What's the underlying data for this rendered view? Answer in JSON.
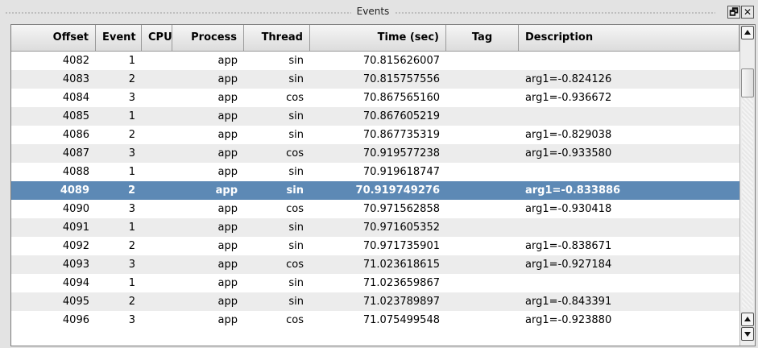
{
  "window": {
    "title": "Events",
    "float_button_glyph": "🗗",
    "close_button_glyph": "✕"
  },
  "table": {
    "columns": [
      {
        "key": "offset",
        "label": "Offset",
        "align": "right"
      },
      {
        "key": "event",
        "label": "Event",
        "align": "right"
      },
      {
        "key": "cpu",
        "label": "CPU",
        "align": "center"
      },
      {
        "key": "process",
        "label": "Process",
        "align": "right"
      },
      {
        "key": "thread",
        "label": "Thread",
        "align": "right"
      },
      {
        "key": "time",
        "label": "Time (sec)",
        "align": "right"
      },
      {
        "key": "tag",
        "label": "Tag",
        "align": "center"
      },
      {
        "key": "description",
        "label": "Description",
        "align": "left"
      }
    ],
    "selected_offset": "4089",
    "rows": [
      {
        "offset": "4082",
        "event": "1",
        "cpu": "",
        "process": "app",
        "thread": "sin",
        "time": "70.815626007",
        "tag": "",
        "description": ""
      },
      {
        "offset": "4083",
        "event": "2",
        "cpu": "",
        "process": "app",
        "thread": "sin",
        "time": "70.815757556",
        "tag": "",
        "description": "arg1=-0.824126"
      },
      {
        "offset": "4084",
        "event": "3",
        "cpu": "",
        "process": "app",
        "thread": "cos",
        "time": "70.867565160",
        "tag": "",
        "description": "arg1=-0.936672"
      },
      {
        "offset": "4085",
        "event": "1",
        "cpu": "",
        "process": "app",
        "thread": "sin",
        "time": "70.867605219",
        "tag": "",
        "description": ""
      },
      {
        "offset": "4086",
        "event": "2",
        "cpu": "",
        "process": "app",
        "thread": "sin",
        "time": "70.867735319",
        "tag": "",
        "description": "arg1=-0.829038"
      },
      {
        "offset": "4087",
        "event": "3",
        "cpu": "",
        "process": "app",
        "thread": "cos",
        "time": "70.919577238",
        "tag": "",
        "description": "arg1=-0.933580"
      },
      {
        "offset": "4088",
        "event": "1",
        "cpu": "",
        "process": "app",
        "thread": "sin",
        "time": "70.919618747",
        "tag": "",
        "description": ""
      },
      {
        "offset": "4089",
        "event": "2",
        "cpu": "",
        "process": "app",
        "thread": "sin",
        "time": "70.919749276",
        "tag": "",
        "description": "arg1=-0.833886"
      },
      {
        "offset": "4090",
        "event": "3",
        "cpu": "",
        "process": "app",
        "thread": "cos",
        "time": "70.971562858",
        "tag": "",
        "description": "arg1=-0.930418"
      },
      {
        "offset": "4091",
        "event": "1",
        "cpu": "",
        "process": "app",
        "thread": "sin",
        "time": "70.971605352",
        "tag": "",
        "description": ""
      },
      {
        "offset": "4092",
        "event": "2",
        "cpu": "",
        "process": "app",
        "thread": "sin",
        "time": "70.971735901",
        "tag": "",
        "description": "arg1=-0.838671"
      },
      {
        "offset": "4093",
        "event": "3",
        "cpu": "",
        "process": "app",
        "thread": "cos",
        "time": "71.023618615",
        "tag": "",
        "description": "arg1=-0.927184"
      },
      {
        "offset": "4094",
        "event": "1",
        "cpu": "",
        "process": "app",
        "thread": "sin",
        "time": "71.023659867",
        "tag": "",
        "description": ""
      },
      {
        "offset": "4095",
        "event": "2",
        "cpu": "",
        "process": "app",
        "thread": "sin",
        "time": "71.023789897",
        "tag": "",
        "description": "arg1=-0.843391"
      },
      {
        "offset": "4096",
        "event": "3",
        "cpu": "",
        "process": "app",
        "thread": "cos",
        "time": "71.075499548",
        "tag": "",
        "description": "arg1=-0.923880"
      }
    ]
  },
  "colors": {
    "selection": "#5d89b5",
    "alt_row": "#ececec",
    "panel": "#e3e3e3"
  }
}
